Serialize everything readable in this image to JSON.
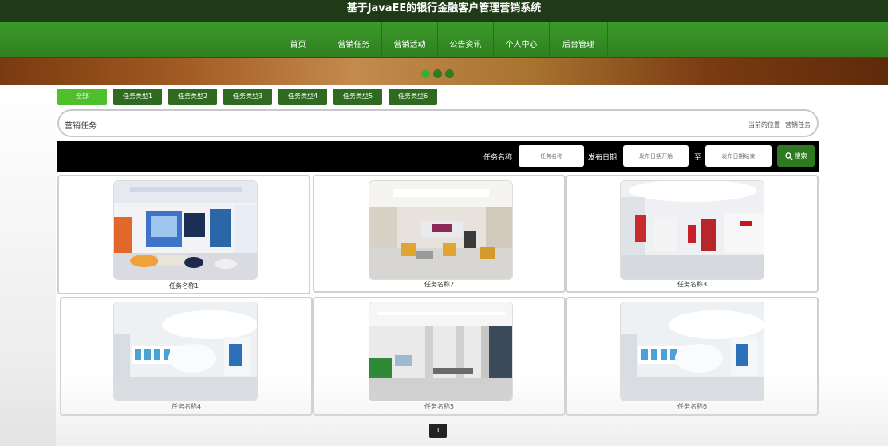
{
  "header": {
    "title": "基于JavaEE的银行金融客户管理营销系统"
  },
  "nav": {
    "items": [
      {
        "label": "首页",
        "key": "home"
      },
      {
        "label": "营销任务",
        "key": "tasks"
      },
      {
        "label": "营销活动",
        "key": "activities"
      },
      {
        "label": "公告资讯",
        "key": "news"
      },
      {
        "label": "个人中心",
        "key": "profile"
      },
      {
        "label": "后台管理",
        "key": "admin"
      }
    ]
  },
  "banner": {
    "dots": 3,
    "active_dot": 0
  },
  "categories": [
    {
      "label": "全部",
      "active": true
    },
    {
      "label": "任务类型1",
      "active": false
    },
    {
      "label": "任务类型2",
      "active": false
    },
    {
      "label": "任务类型3",
      "active": false
    },
    {
      "label": "任务类型4",
      "active": false
    },
    {
      "label": "任务类型5",
      "active": false
    },
    {
      "label": "任务类型6",
      "active": false
    }
  ],
  "breadcrumb": {
    "title": "营销任务",
    "location_label": "当前的位置",
    "current": "营销任务"
  },
  "search": {
    "name_label": "任务名称",
    "name_placeholder": "任务名称",
    "date_label": "发布日期",
    "date_start_placeholder": "发布日期开始",
    "date_sep": "至",
    "date_end_placeholder": "发布日期结束",
    "button_label": "搜索"
  },
  "cards": [
    {
      "name": "任务名称1",
      "scene": "lounge-blue"
    },
    {
      "name": "任务名称2",
      "scene": "hall-yellow-seats"
    },
    {
      "name": "任务名称3",
      "scene": "lobby-red-counter"
    },
    {
      "name": "任务名称4",
      "scene": "hall-curved-white"
    },
    {
      "name": "任务名称5",
      "scene": "hall-columns-plants"
    },
    {
      "name": "任务名称6",
      "scene": "hall-curved-white"
    }
  ],
  "pagination": {
    "current": "1"
  },
  "colors": {
    "nav_green": "#3c9a2a",
    "title_bar": "#1e3a17",
    "category_button": "#2e6b21",
    "category_active": "#4fbf2c",
    "search_bar": "#000000"
  }
}
